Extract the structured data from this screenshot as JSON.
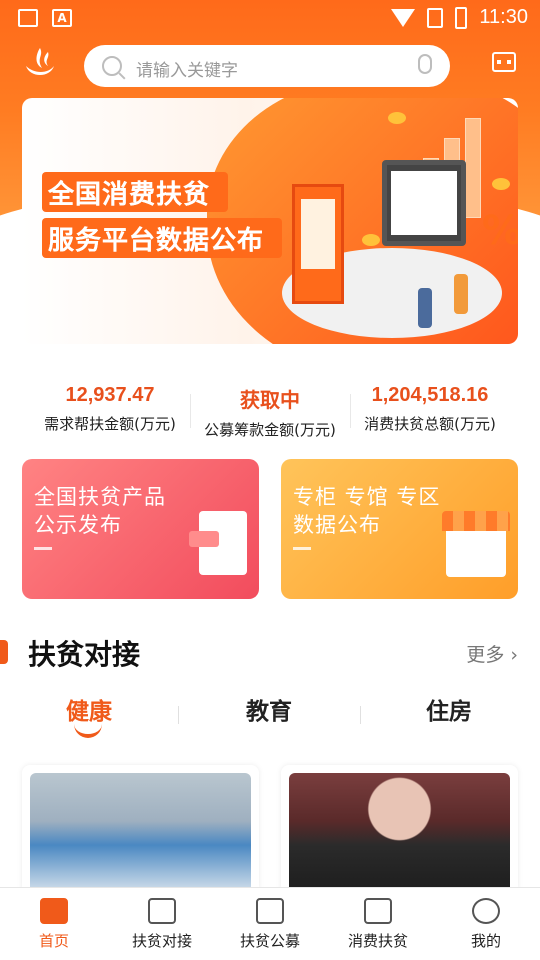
{
  "status_bar": {
    "time": "11:30",
    "icons": [
      "image-icon",
      "font-icon",
      "wifi-icon",
      "no-sim-icon",
      "battery-charging-icon"
    ]
  },
  "header": {
    "logo": "app-logo",
    "search_placeholder": "请输入关键字",
    "search_icon": "search-icon",
    "mic_icon": "microphone-icon",
    "scan_icon": "scan-icon"
  },
  "banner": {
    "line1": "全国消费扶贫",
    "line2": "服务平台数据公布"
  },
  "stats": [
    {
      "value": "12,937.47",
      "label": "需求帮扶金额(万元)"
    },
    {
      "value": "获取中",
      "label": "公募筹款金额(万元)"
    },
    {
      "value": "1,204,518.16",
      "label": "消费扶贫总额(万元)"
    }
  ],
  "cards": [
    {
      "line1": "全国扶贫产品",
      "line2": "公示发布",
      "icon": "document-icon"
    },
    {
      "line1": "专柜 专馆 专区",
      "line2": "数据公布",
      "icon": "store-icon"
    }
  ],
  "section": {
    "title": "扶贫对接",
    "more": "更多"
  },
  "tabs": [
    {
      "label": "健康",
      "active": true
    },
    {
      "label": "教育",
      "active": false
    },
    {
      "label": "住房",
      "active": false
    }
  ],
  "bottom_nav": [
    {
      "label": "首页",
      "icon": "home-icon",
      "active": true
    },
    {
      "label": "扶贫对接",
      "icon": "handshake-icon",
      "active": false
    },
    {
      "label": "扶贫公募",
      "icon": "clipboard-icon",
      "active": false
    },
    {
      "label": "消费扶贫",
      "icon": "shopping-bag-icon",
      "active": false
    },
    {
      "label": "我的",
      "icon": "user-icon",
      "active": false
    }
  ],
  "colors": {
    "accent": "#f05a1a",
    "header": "#ff6a1a",
    "card_red": "#f24c5d",
    "card_orange": "#ff9e29"
  }
}
